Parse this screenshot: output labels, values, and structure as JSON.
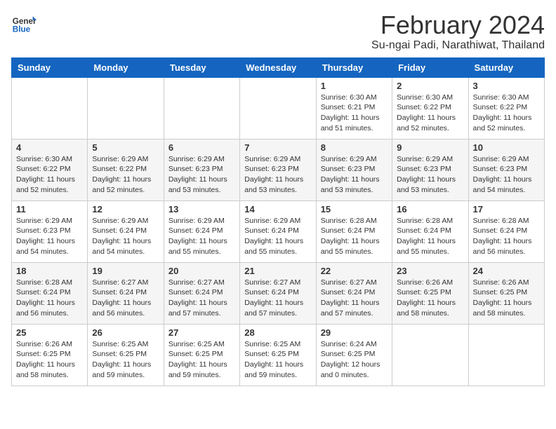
{
  "logo": {
    "line1": "General",
    "line2": "Blue"
  },
  "title": "February 2024",
  "subtitle": "Su-ngai Padi, Narathiwat, Thailand",
  "days_of_week": [
    "Sunday",
    "Monday",
    "Tuesday",
    "Wednesday",
    "Thursday",
    "Friday",
    "Saturday"
  ],
  "weeks": [
    [
      {
        "day": "",
        "info": ""
      },
      {
        "day": "",
        "info": ""
      },
      {
        "day": "",
        "info": ""
      },
      {
        "day": "",
        "info": ""
      },
      {
        "day": "1",
        "info": "Sunrise: 6:30 AM\nSunset: 6:21 PM\nDaylight: 11 hours\nand 51 minutes."
      },
      {
        "day": "2",
        "info": "Sunrise: 6:30 AM\nSunset: 6:22 PM\nDaylight: 11 hours\nand 52 minutes."
      },
      {
        "day": "3",
        "info": "Sunrise: 6:30 AM\nSunset: 6:22 PM\nDaylight: 11 hours\nand 52 minutes."
      }
    ],
    [
      {
        "day": "4",
        "info": "Sunrise: 6:30 AM\nSunset: 6:22 PM\nDaylight: 11 hours\nand 52 minutes."
      },
      {
        "day": "5",
        "info": "Sunrise: 6:29 AM\nSunset: 6:22 PM\nDaylight: 11 hours\nand 52 minutes."
      },
      {
        "day": "6",
        "info": "Sunrise: 6:29 AM\nSunset: 6:23 PM\nDaylight: 11 hours\nand 53 minutes."
      },
      {
        "day": "7",
        "info": "Sunrise: 6:29 AM\nSunset: 6:23 PM\nDaylight: 11 hours\nand 53 minutes."
      },
      {
        "day": "8",
        "info": "Sunrise: 6:29 AM\nSunset: 6:23 PM\nDaylight: 11 hours\nand 53 minutes."
      },
      {
        "day": "9",
        "info": "Sunrise: 6:29 AM\nSunset: 6:23 PM\nDaylight: 11 hours\nand 53 minutes."
      },
      {
        "day": "10",
        "info": "Sunrise: 6:29 AM\nSunset: 6:23 PM\nDaylight: 11 hours\nand 54 minutes."
      }
    ],
    [
      {
        "day": "11",
        "info": "Sunrise: 6:29 AM\nSunset: 6:23 PM\nDaylight: 11 hours\nand 54 minutes."
      },
      {
        "day": "12",
        "info": "Sunrise: 6:29 AM\nSunset: 6:24 PM\nDaylight: 11 hours\nand 54 minutes."
      },
      {
        "day": "13",
        "info": "Sunrise: 6:29 AM\nSunset: 6:24 PM\nDaylight: 11 hours\nand 55 minutes."
      },
      {
        "day": "14",
        "info": "Sunrise: 6:29 AM\nSunset: 6:24 PM\nDaylight: 11 hours\nand 55 minutes."
      },
      {
        "day": "15",
        "info": "Sunrise: 6:28 AM\nSunset: 6:24 PM\nDaylight: 11 hours\nand 55 minutes."
      },
      {
        "day": "16",
        "info": "Sunrise: 6:28 AM\nSunset: 6:24 PM\nDaylight: 11 hours\nand 55 minutes."
      },
      {
        "day": "17",
        "info": "Sunrise: 6:28 AM\nSunset: 6:24 PM\nDaylight: 11 hours\nand 56 minutes."
      }
    ],
    [
      {
        "day": "18",
        "info": "Sunrise: 6:28 AM\nSunset: 6:24 PM\nDaylight: 11 hours\nand 56 minutes."
      },
      {
        "day": "19",
        "info": "Sunrise: 6:27 AM\nSunset: 6:24 PM\nDaylight: 11 hours\nand 56 minutes."
      },
      {
        "day": "20",
        "info": "Sunrise: 6:27 AM\nSunset: 6:24 PM\nDaylight: 11 hours\nand 57 minutes."
      },
      {
        "day": "21",
        "info": "Sunrise: 6:27 AM\nSunset: 6:24 PM\nDaylight: 11 hours\nand 57 minutes."
      },
      {
        "day": "22",
        "info": "Sunrise: 6:27 AM\nSunset: 6:24 PM\nDaylight: 11 hours\nand 57 minutes."
      },
      {
        "day": "23",
        "info": "Sunrise: 6:26 AM\nSunset: 6:25 PM\nDaylight: 11 hours\nand 58 minutes."
      },
      {
        "day": "24",
        "info": "Sunrise: 6:26 AM\nSunset: 6:25 PM\nDaylight: 11 hours\nand 58 minutes."
      }
    ],
    [
      {
        "day": "25",
        "info": "Sunrise: 6:26 AM\nSunset: 6:25 PM\nDaylight: 11 hours\nand 58 minutes."
      },
      {
        "day": "26",
        "info": "Sunrise: 6:25 AM\nSunset: 6:25 PM\nDaylight: 11 hours\nand 59 minutes."
      },
      {
        "day": "27",
        "info": "Sunrise: 6:25 AM\nSunset: 6:25 PM\nDaylight: 11 hours\nand 59 minutes."
      },
      {
        "day": "28",
        "info": "Sunrise: 6:25 AM\nSunset: 6:25 PM\nDaylight: 11 hours\nand 59 minutes."
      },
      {
        "day": "29",
        "info": "Sunrise: 6:24 AM\nSunset: 6:25 PM\nDaylight: 12 hours\nand 0 minutes."
      },
      {
        "day": "",
        "info": ""
      },
      {
        "day": "",
        "info": ""
      }
    ]
  ]
}
